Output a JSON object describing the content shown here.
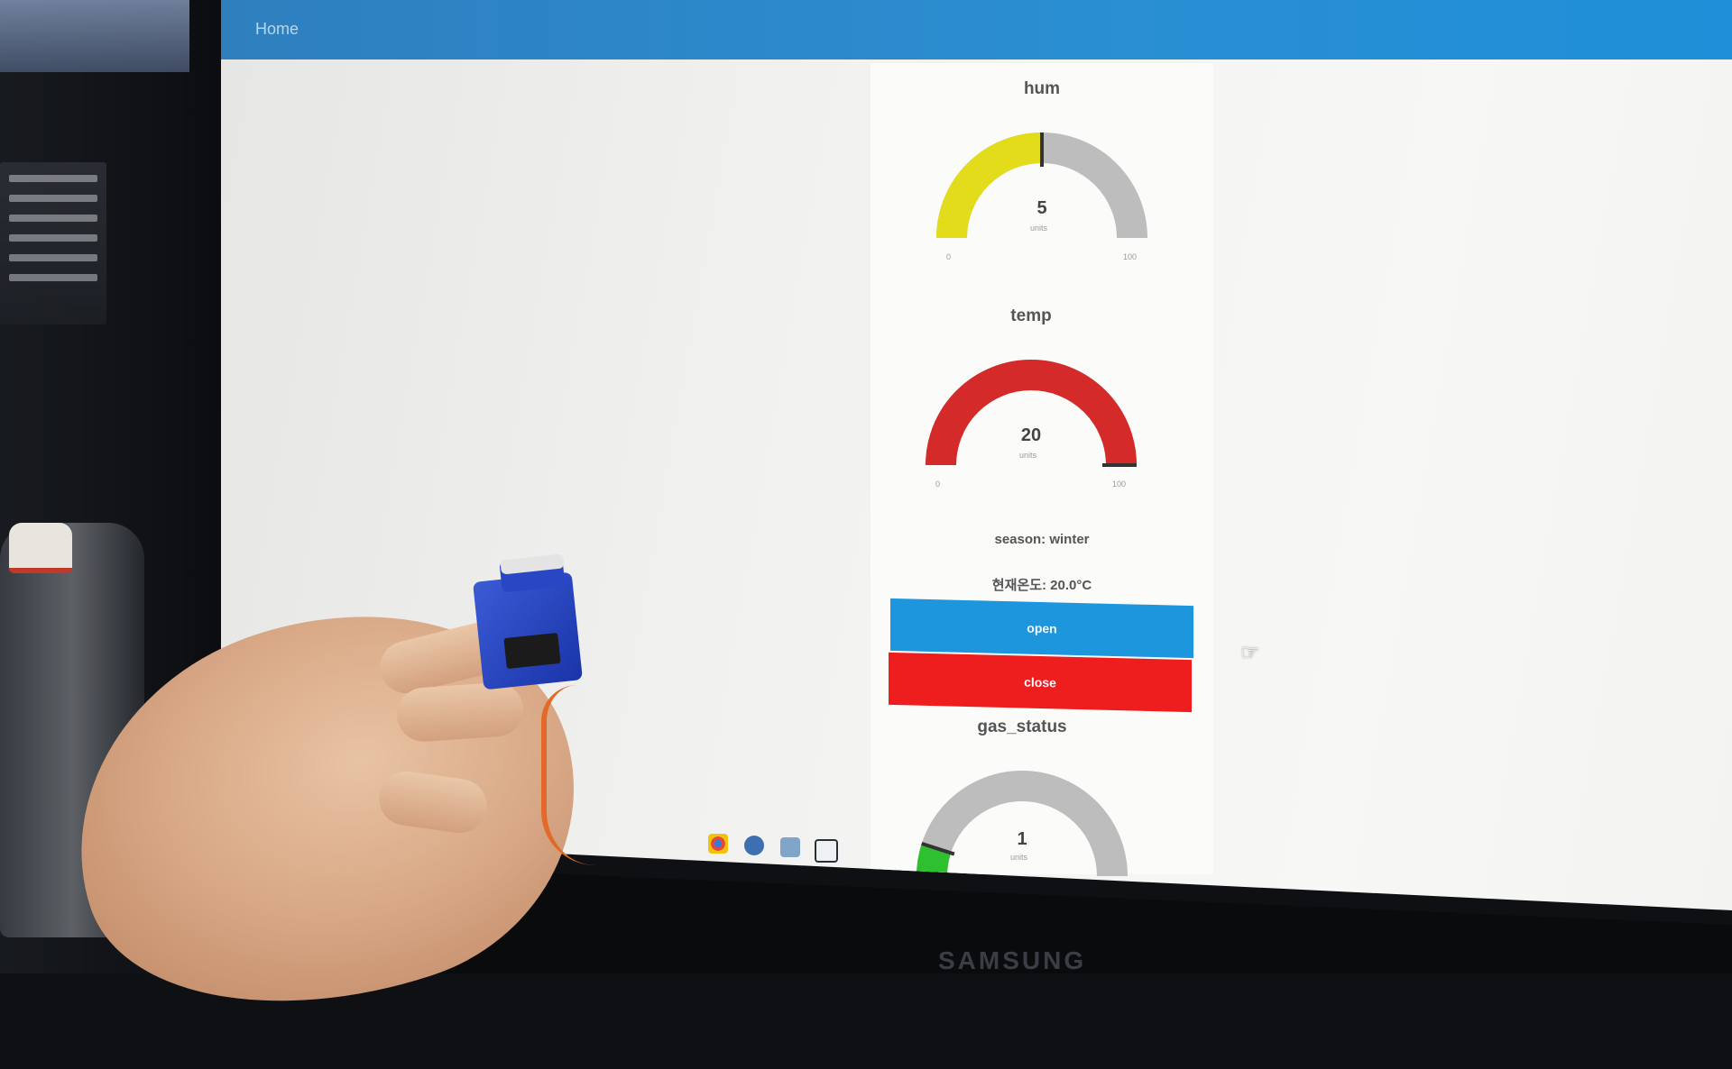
{
  "app": {
    "title": "Home"
  },
  "gauges": [
    {
      "id": "hum",
      "title": "hum",
      "value": "5",
      "value_num": 5,
      "min": "0",
      "max": "100",
      "units": "units",
      "color": "#e2dc1a",
      "fill_fraction": 0.5
    },
    {
      "id": "temp",
      "title": "temp",
      "value": "20",
      "value_num": 20,
      "min": "0",
      "max": "100",
      "units": "units",
      "color": "#d42a2a",
      "fill_fraction": 1.0
    },
    {
      "id": "gas",
      "title": "gas_status",
      "value": "1",
      "value_num": 1,
      "min": "0",
      "max": "10",
      "units": "units",
      "color": "#2ec02e",
      "fill_fraction": 0.1
    }
  ],
  "season_line": "season: winter",
  "current_temp_line": "현재온도: 20.0°C",
  "buttons": {
    "open": "open",
    "close": "close"
  },
  "colors": {
    "topbar": "#2a8fd3",
    "open_button": "#1e96dd",
    "close_button": "#ee1e1e",
    "gauge_track": "#bdbdbd"
  },
  "taskbar_icons": [
    "chrome-icon",
    "settings-icon",
    "files-icon",
    "window-icon"
  ],
  "monitor_brand": "SAMSUNG"
}
